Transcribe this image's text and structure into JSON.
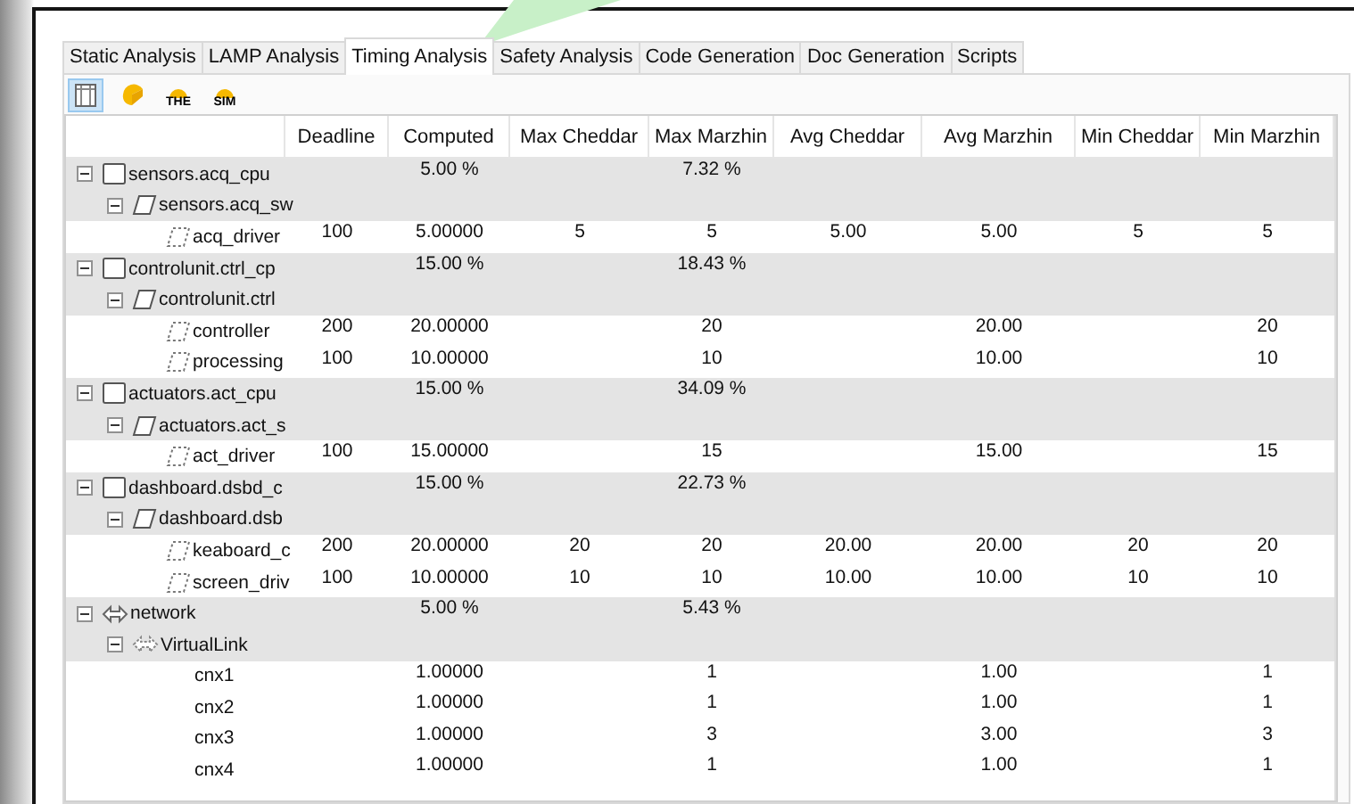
{
  "tabs": [
    {
      "label": "Static Analysis",
      "selected": false
    },
    {
      "label": "LAMP Analysis",
      "selected": false
    },
    {
      "label": "Timing Analysis",
      "selected": true
    },
    {
      "label": "Safety Analysis",
      "selected": false
    },
    {
      "label": "Code Generation",
      "selected": false
    },
    {
      "label": "Doc Generation",
      "selected": false
    },
    {
      "label": "Scripts",
      "selected": false
    }
  ],
  "toolbar": [
    {
      "kind": "table",
      "selected": true
    },
    {
      "kind": "cheese",
      "selected": false
    },
    {
      "kind": "badge",
      "label": "THE",
      "selected": false
    },
    {
      "kind": "badge",
      "label": "SIM",
      "selected": false
    }
  ],
  "table": {
    "columns": [
      "Deadline",
      "Computed",
      "Max Cheddar",
      "Max Marzhin",
      "Avg Cheddar",
      "Avg Marzhin",
      "Min Cheddar",
      "Min Marzhin"
    ],
    "rows": [
      {
        "kind": "cpu",
        "name": "sensors.acq_cpu",
        "expanded": true,
        "cells": [
          null,
          "5.00 %",
          null,
          "7.32 %",
          null,
          null,
          null,
          null
        ],
        "children": [
          {
            "kind": "software",
            "name": "sensors.acq_sw",
            "expanded": true,
            "children": [
              {
                "kind": "task",
                "name": "acq_driver",
                "cells": [
                  "100",
                  "5.00000",
                  "5",
                  "5",
                  "5.00",
                  "5.00",
                  "5",
                  "5"
                ]
              }
            ]
          }
        ]
      },
      {
        "kind": "cpu",
        "name": "controlunit.ctrl_cp",
        "expanded": true,
        "cells": [
          null,
          "15.00 %",
          null,
          "18.43 %",
          null,
          null,
          null,
          null
        ],
        "children": [
          {
            "kind": "software",
            "name": "controlunit.ctrl",
            "expanded": true,
            "children": [
              {
                "kind": "task",
                "name": "controller",
                "cells": [
                  "200",
                  "20.00000",
                  null,
                  "20",
                  null,
                  "20.00",
                  null,
                  "20"
                ]
              },
              {
                "kind": "task",
                "name": "processing",
                "cells": [
                  "100",
                  "10.00000",
                  null,
                  "10",
                  null,
                  "10.00",
                  null,
                  "10"
                ]
              }
            ]
          }
        ]
      },
      {
        "kind": "cpu",
        "name": "actuators.act_cpu",
        "expanded": true,
        "cells": [
          null,
          "15.00 %",
          null,
          "34.09 %",
          null,
          null,
          null,
          null
        ],
        "children": [
          {
            "kind": "software",
            "name": "actuators.act_s",
            "expanded": true,
            "children": [
              {
                "kind": "task",
                "name": "act_driver",
                "cells": [
                  "100",
                  "15.00000",
                  null,
                  "15",
                  null,
                  "15.00",
                  null,
                  "15"
                ]
              }
            ]
          }
        ]
      },
      {
        "kind": "cpu",
        "name": "dashboard.dsbd_c",
        "expanded": true,
        "cells": [
          null,
          "15.00 %",
          null,
          "22.73 %",
          null,
          null,
          null,
          null
        ],
        "children": [
          {
            "kind": "software",
            "name": "dashboard.dsb",
            "expanded": true,
            "children": [
              {
                "kind": "task",
                "name": "keaboard_c",
                "cells": [
                  "200",
                  "20.00000",
                  "20",
                  "20",
                  "20.00",
                  "20.00",
                  "20",
                  "20"
                ]
              },
              {
                "kind": "task",
                "name": "screen_driv",
                "cells": [
                  "100",
                  "10.00000",
                  "10",
                  "10",
                  "10.00",
                  "10.00",
                  "10",
                  "10"
                ]
              }
            ]
          }
        ]
      },
      {
        "kind": "network",
        "name": "network",
        "expanded": true,
        "cells": [
          null,
          "5.00 %",
          null,
          "5.43 %",
          null,
          null,
          null,
          null
        ],
        "children": [
          {
            "kind": "link",
            "name": "VirtualLink",
            "expanded": true,
            "children": [
              {
                "kind": "connection",
                "name": "cnx1",
                "cells": [
                  null,
                  "1.00000",
                  null,
                  "1",
                  null,
                  "1.00",
                  null,
                  "1"
                ]
              },
              {
                "kind": "connection",
                "name": "cnx2",
                "cells": [
                  null,
                  "1.00000",
                  null,
                  "1",
                  null,
                  "1.00",
                  null,
                  "1"
                ]
              },
              {
                "kind": "connection",
                "name": "cnx3",
                "cells": [
                  null,
                  "1.00000",
                  null,
                  "3",
                  null,
                  "3.00",
                  null,
                  "3"
                ]
              },
              {
                "kind": "connection",
                "name": "cnx4",
                "cells": [
                  null,
                  "1.00000",
                  null,
                  "1",
                  null,
                  "1.00",
                  null,
                  "1"
                ]
              }
            ]
          }
        ]
      }
    ]
  }
}
